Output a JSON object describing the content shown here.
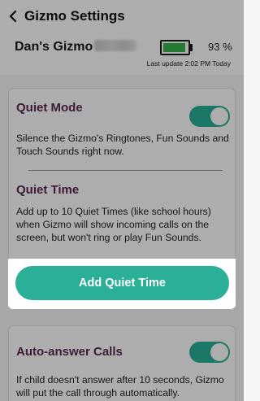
{
  "header": {
    "title": "Gizmo Settings",
    "back_icon": "chevron-left-icon"
  },
  "device": {
    "name": "Dan's Gizmo",
    "battery_percent": "93 %",
    "battery_level": 0.93,
    "battery_color": "#35b54a",
    "last_update": "Last update 2:02 PM Today"
  },
  "quiet_mode": {
    "title": "Quiet Mode",
    "description": "Silence the Gizmo's Ringtones, Fun Sounds and Touch Sounds right now.",
    "enabled": true
  },
  "quiet_time": {
    "title": "Quiet Time",
    "description": "Add up to 10 Quiet Times (like school hours) when Gizmo will show incoming calls on the screen, but won't ring or play Fun Sounds.",
    "button_label": "Add Quiet Time"
  },
  "auto_answer": {
    "title": "Auto-answer Calls",
    "description": "If child doesn't answer after 10 seconds, Gizmo will put the call through automatically.",
    "enabled": true
  },
  "colors": {
    "accent": "#2bb097",
    "title": "#5c2a52",
    "battery": "#35b54a"
  }
}
